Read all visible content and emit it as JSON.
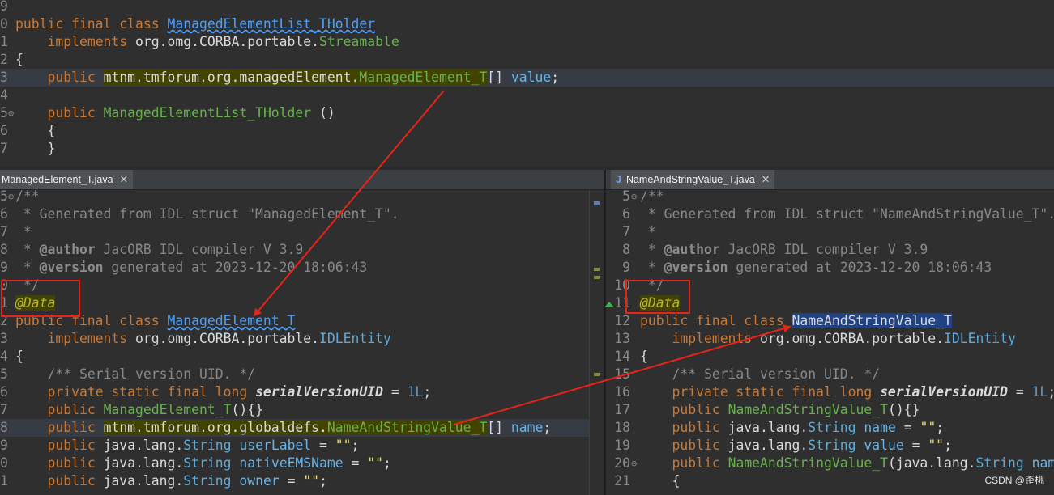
{
  "top": {
    "lines": [
      {
        "n": "9",
        "fold": false,
        "hl": false,
        "html": ""
      },
      {
        "n": "0",
        "fold": false,
        "hl": false,
        "html": "<span class='kw'>public final class</span> <span class='link'>ManagedElementList_THolder</span>"
      },
      {
        "n": "1",
        "fold": false,
        "hl": false,
        "html": "    <span class='kw'>implements</span> org.omg.CORBA.portable.<span class='cls'>Streamable</span>"
      },
      {
        "n": "2",
        "fold": false,
        "hl": false,
        "html": "{"
      },
      {
        "n": "3",
        "fold": false,
        "hl": true,
        "html": "    <span class='kw'>public</span> <span class='olive'>mtnm.tmforum.org.managedElement.<span class='cls'>ManagedElement_T</span></span>[] <span class='fld'>value</span>;"
      },
      {
        "n": "4",
        "fold": false,
        "hl": false,
        "html": ""
      },
      {
        "n": "5",
        "fold": true,
        "hl": false,
        "html": "    <span class='kw'>public</span> <span class='cls'>ManagedElementList_THolder</span> ()"
      },
      {
        "n": "6",
        "fold": false,
        "hl": false,
        "html": "    {"
      },
      {
        "n": "7",
        "fold": false,
        "hl": false,
        "html": "    }"
      }
    ]
  },
  "left": {
    "tab": "ManagedElement_T.java",
    "lines": [
      {
        "n": "5",
        "fold": true,
        "hl": false,
        "html": "<span class='com'>/**</span>"
      },
      {
        "n": "6",
        "fold": false,
        "hl": false,
        "html": "<span class='com'> * Generated from IDL struct \"ManagedElement_T\".</span>"
      },
      {
        "n": "7",
        "fold": false,
        "hl": false,
        "html": "<span class='com'> *</span>"
      },
      {
        "n": "8",
        "fold": false,
        "hl": false,
        "html": "<span class='com'> * </span><span class='jd'>@author</span><span class='com'> JacORB IDL compiler V 3.9</span>"
      },
      {
        "n": "9",
        "fold": false,
        "hl": false,
        "html": "<span class='com'> * </span><span class='jd'>@version</span><span class='com'> generated at 2023-12-20 18:06:43</span>"
      },
      {
        "n": "0",
        "fold": false,
        "hl": false,
        "html": "<span class='com'> */</span>"
      },
      {
        "n": "1",
        "fold": false,
        "hl": false,
        "html": "<span class='anno olive'>@Data</span>"
      },
      {
        "n": "2",
        "fold": false,
        "hl": false,
        "html": "<span class='kw'>public final class</span> <span class='link'>ManagedElement_T</span>"
      },
      {
        "n": "3",
        "fold": false,
        "hl": false,
        "html": "    <span class='kw'>implements</span> org.omg.CORBA.portable.<span class='ty'>IDLEntity</span>"
      },
      {
        "n": "4",
        "fold": false,
        "hl": false,
        "html": "{"
      },
      {
        "n": "5",
        "fold": false,
        "hl": false,
        "html": "    <span class='com'>/** Serial version UID. */</span>"
      },
      {
        "n": "6",
        "fold": false,
        "hl": false,
        "html": "    <span class='kw'>private static final long</span> <span class='sfld'>serialVersionUID</span> = <span class='num'>1L</span>;"
      },
      {
        "n": "7",
        "fold": false,
        "hl": false,
        "html": "    <span class='kw'>public</span> <span class='cls'>ManagedElement_T</span>(){}"
      },
      {
        "n": "8",
        "fold": false,
        "hl": true,
        "html": "    <span class='kw'>public</span> <span class='olive'>mtnm.tmforum.org.globaldefs.<span class='cls'>NameAndStringValue_T</span></span>[] <span class='fld'>name</span>;"
      },
      {
        "n": "9",
        "fold": false,
        "hl": false,
        "html": "    <span class='kw'>public</span> java.lang.<span class='ty'>String</span> <span class='fld'>userLabel</span> = <span class='str'>\"\"</span>;"
      },
      {
        "n": "0",
        "fold": false,
        "hl": false,
        "html": "    <span class='kw'>public</span> java.lang.<span class='ty'>String</span> <span class='fld'>nativeEMSName</span> = <span class='str'>\"\"</span>;"
      },
      {
        "n": "1",
        "fold": false,
        "hl": false,
        "html": "    <span class='kw'>public</span> java.lang.<span class='ty'>String</span> <span class='fld'>owner</span> = <span class='str'>\"\"</span>;"
      }
    ]
  },
  "right": {
    "tab": "NameAndStringValue_T.java",
    "lines": [
      {
        "n": "5",
        "fold": true,
        "hl": false,
        "html": "<span class='com'>/**</span>"
      },
      {
        "n": "6",
        "fold": false,
        "hl": false,
        "html": "<span class='com'> * Generated from IDL struct \"NameAndStringValue_T\".</span>"
      },
      {
        "n": "7",
        "fold": false,
        "hl": false,
        "html": "<span class='com'> *</span>"
      },
      {
        "n": "8",
        "fold": false,
        "hl": false,
        "html": "<span class='com'> * </span><span class='jd'>@author</span><span class='com'> JacORB IDL compiler V 3.9</span>"
      },
      {
        "n": "9",
        "fold": false,
        "hl": false,
        "html": "<span class='com'> * </span><span class='jd'>@version</span><span class='com'> generated at 2023-12-20 18:06:43</span>"
      },
      {
        "n": "10",
        "fold": false,
        "hl": false,
        "html": "<span class='com'> */</span>"
      },
      {
        "n": "11",
        "fold": false,
        "hl": false,
        "html": "<span class='anno olive'>@Data</span>"
      },
      {
        "n": "12",
        "fold": false,
        "hl": false,
        "html": "<span class='kw'>public final class</span> <span class='sel'>NameAndStringValue_T</span>"
      },
      {
        "n": "13",
        "fold": false,
        "hl": false,
        "html": "    <span class='kw'>implements</span> org.omg.CORBA.portable.<span class='ty'>IDLEntity</span>"
      },
      {
        "n": "14",
        "fold": false,
        "hl": false,
        "html": "{"
      },
      {
        "n": "15",
        "fold": false,
        "hl": false,
        "html": "    <span class='com'>/** Serial version UID. */</span>"
      },
      {
        "n": "16",
        "fold": false,
        "hl": false,
        "html": "    <span class='kw'>private static final long</span> <span class='sfld'>serialVersionUID</span> = <span class='num'>1L</span>;"
      },
      {
        "n": "17",
        "fold": false,
        "hl": false,
        "html": "    <span class='kw'>public</span> <span class='cls'>NameAndStringValue_T</span>(){}"
      },
      {
        "n": "18",
        "fold": false,
        "hl": false,
        "html": "    <span class='kw'>public</span> java.lang.<span class='ty'>String</span> <span class='fld'>name</span> = <span class='str'>\"\"</span>;"
      },
      {
        "n": "19",
        "fold": false,
        "hl": false,
        "html": "    <span class='kw'>public</span> java.lang.<span class='ty'>String</span> <span class='fld'>value</span> = <span class='str'>\"\"</span>;"
      },
      {
        "n": "20",
        "fold": true,
        "hl": false,
        "html": "    <span class='kw'>public</span> <span class='cls'>NameAndStringValue_T</span>(java.lang.<span class='ty'>String</span> <span class='fld'>name</span>"
      },
      {
        "n": "21",
        "fold": false,
        "hl": false,
        "html": "    {"
      }
    ]
  },
  "watermark": "CSDN @歪桃",
  "colors": {
    "annotation_box": "#e8231a",
    "arrow": "#e8231a"
  }
}
